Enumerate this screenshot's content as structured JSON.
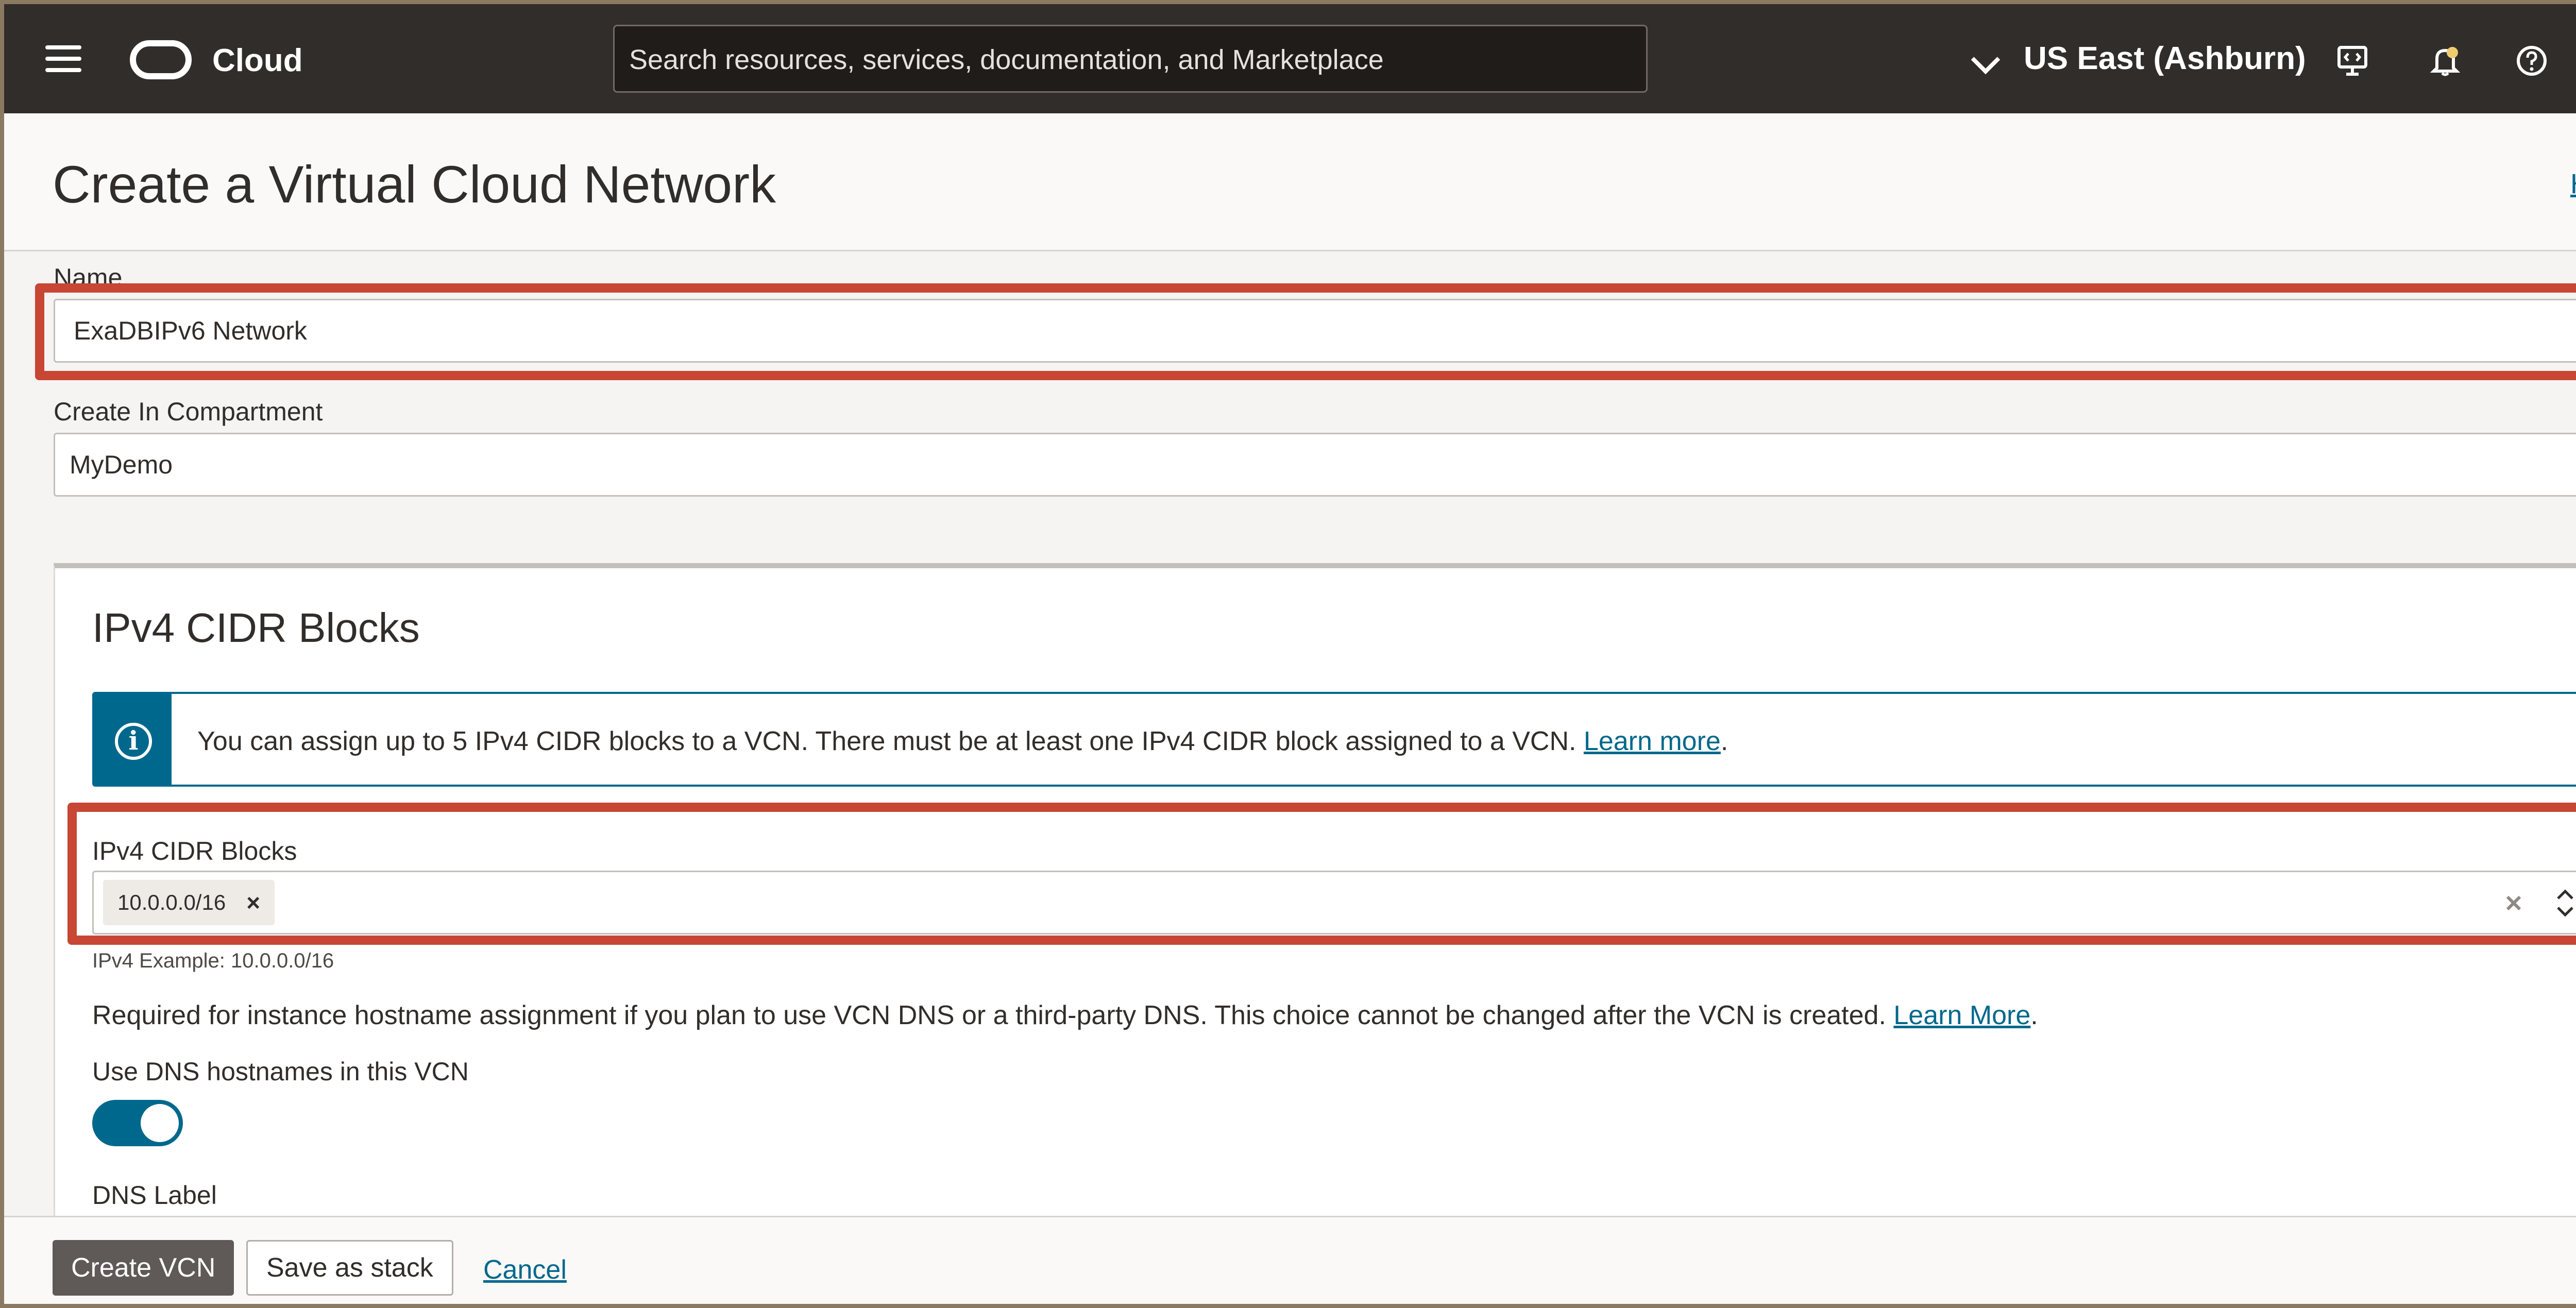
{
  "topbar": {
    "brand": "Cloud",
    "search_placeholder": "Search resources, services, documentation, and Marketplace",
    "region": "US East (Ashburn)"
  },
  "header": {
    "title": "Create a Virtual Cloud Network",
    "help": "Help"
  },
  "form": {
    "name_label": "Name",
    "name_value": "ExaDBIPv6 Network",
    "compartment_label": "Create In Compartment",
    "compartment_value": "MyDemo"
  },
  "cidr_panel": {
    "title": "IPv4 CIDR Blocks",
    "info_text": "You can assign up to 5 IPv4 CIDR blocks to a VCN. There must be at least one IPv4 CIDR block assigned to a VCN.",
    "info_link": "Learn more",
    "field_label": "IPv4 CIDR Blocks",
    "chips": [
      "10.0.0.0/16"
    ],
    "example": "IPv4 Example: 10.0.0.0/16",
    "dns_text": "Required for instance hostname assignment if you plan to use VCN DNS or a third-party DNS. This choice cannot be changed after the VCN is created.",
    "dns_link": "Learn More",
    "dns_toggle_label": "Use DNS hostnames in this VCN",
    "dns_toggle_on": true,
    "dns_label": "DNS Label"
  },
  "footer": {
    "create": "Create VCN",
    "save_stack": "Save as stack",
    "cancel": "Cancel"
  },
  "colors": {
    "topbar": "#312d2a",
    "accent": "#00688c",
    "highlight": "#c74634"
  }
}
